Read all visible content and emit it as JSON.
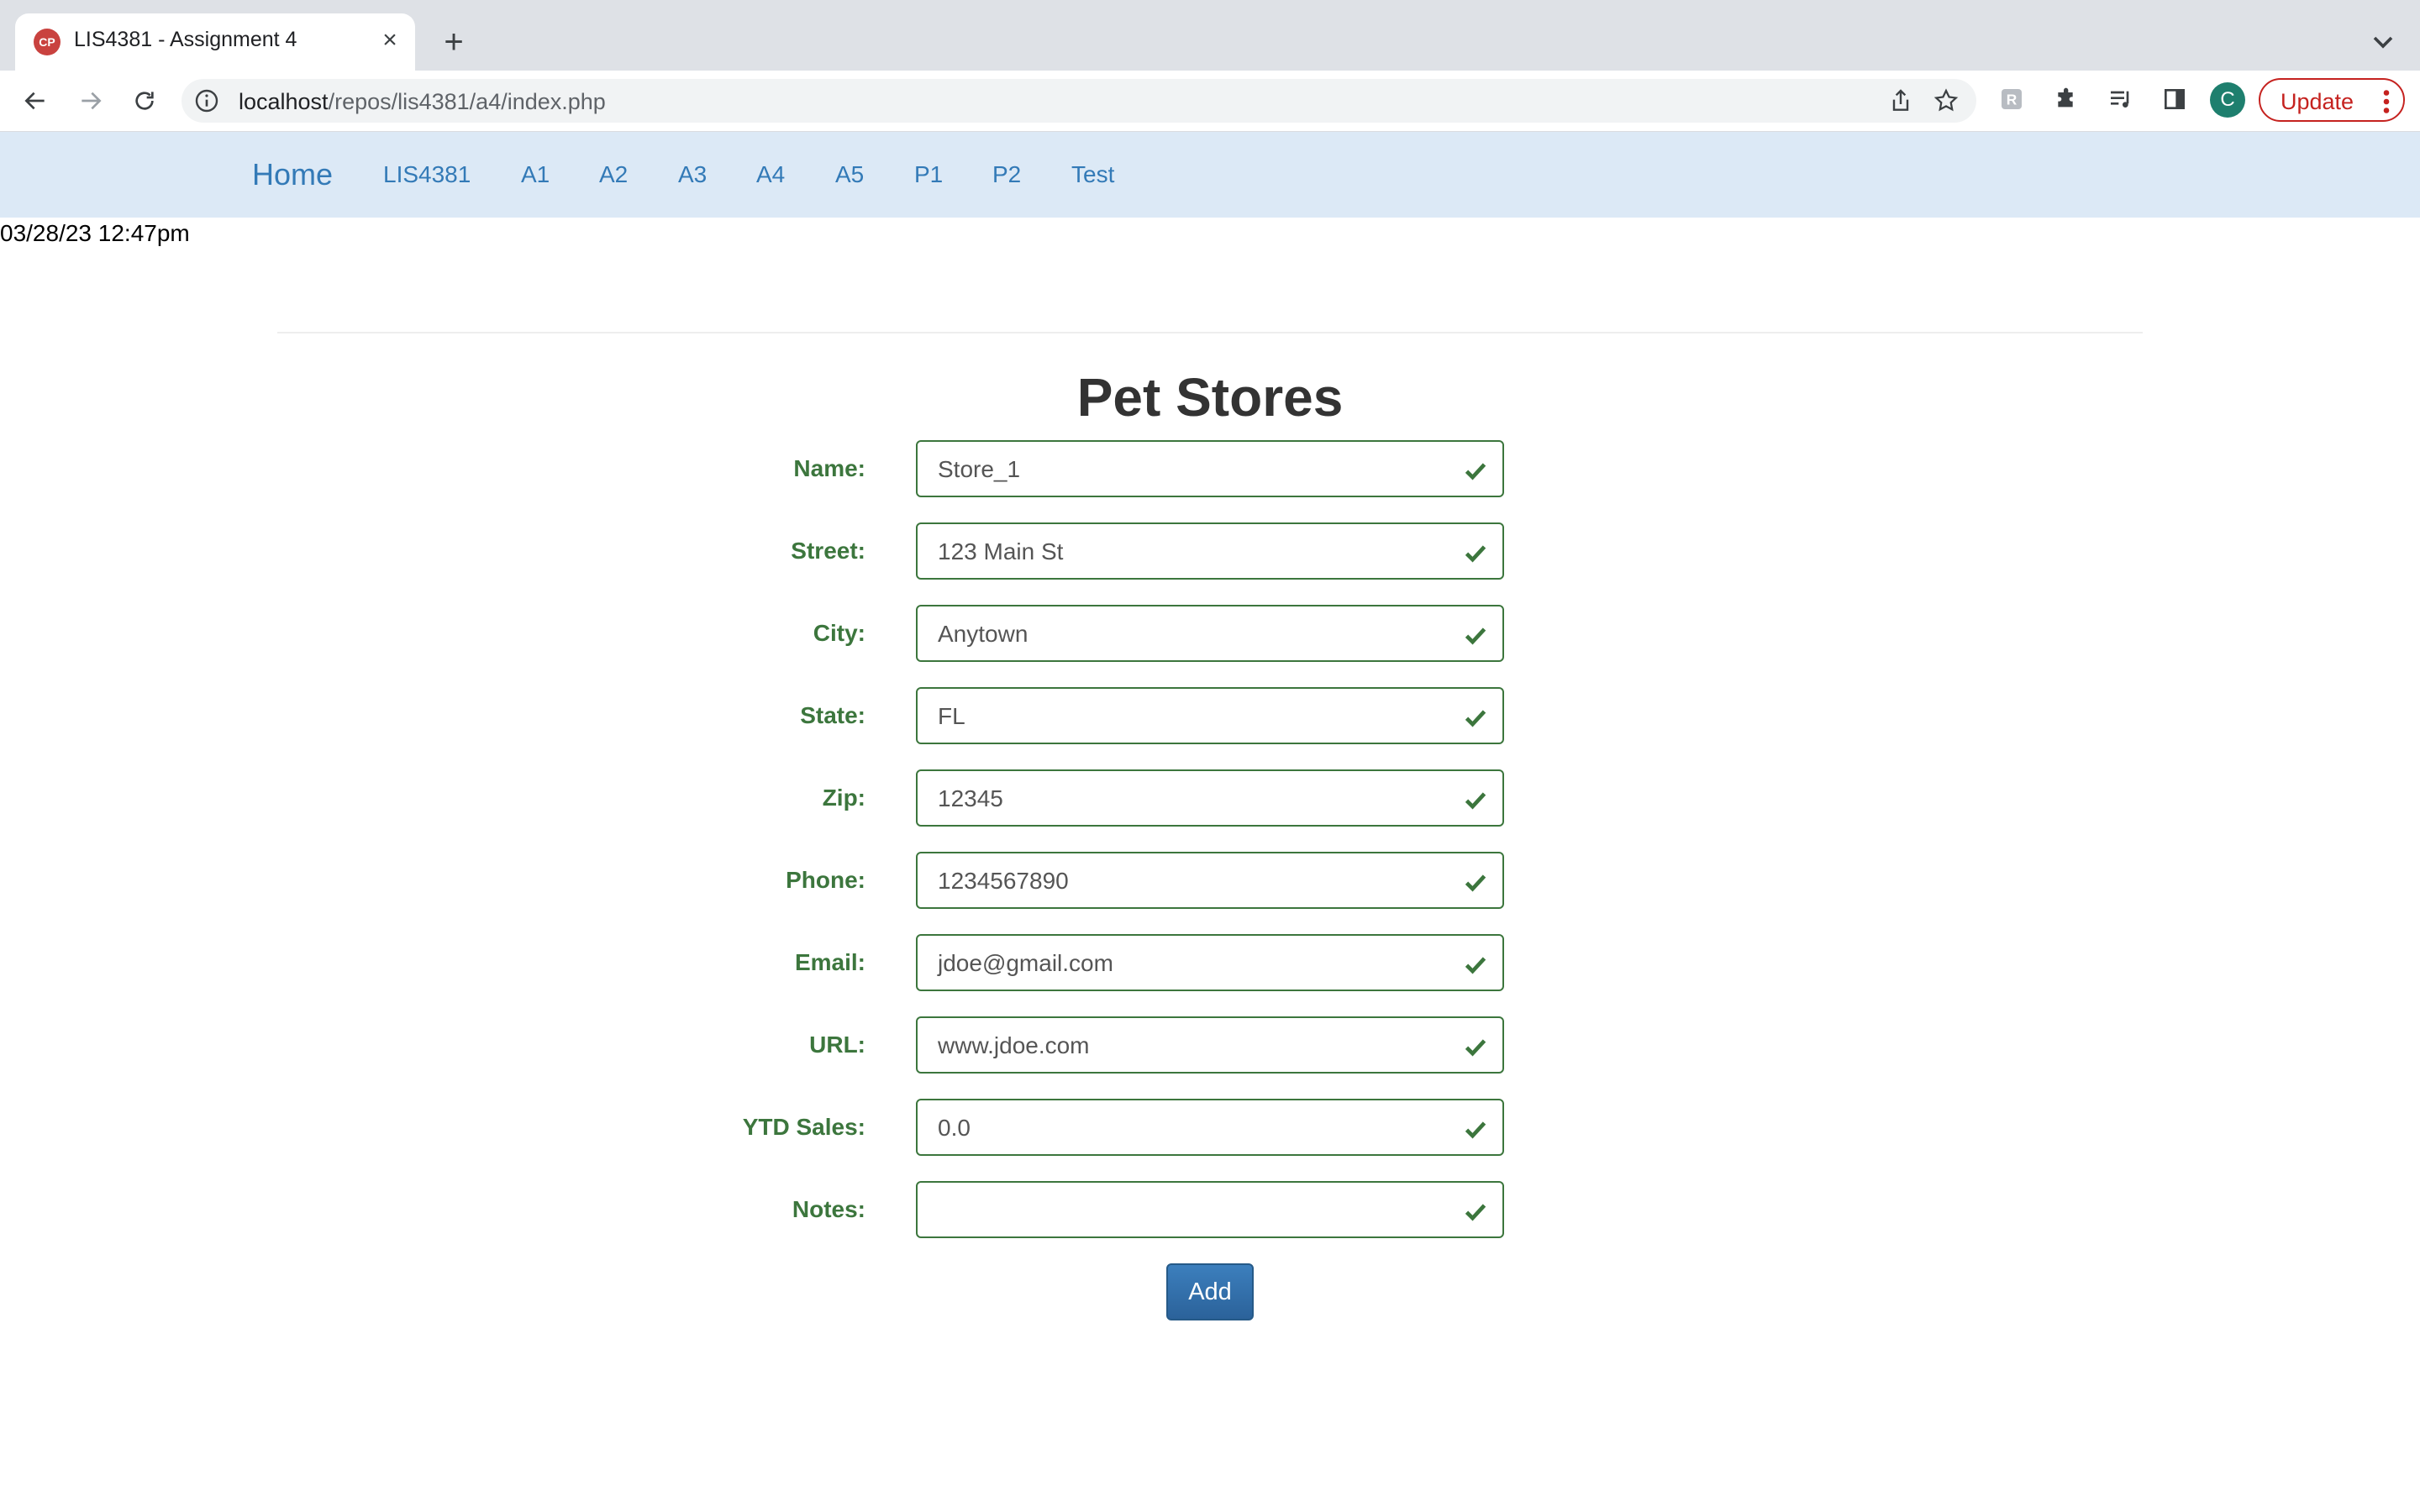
{
  "browser": {
    "tab_title": "LIS4381 - Assignment 4",
    "favicon_text": "CP",
    "url_host": "localhost",
    "url_path": "/repos/lis4381/a4/index.php",
    "avatar_letter": "C",
    "update_label": "Update"
  },
  "nav": {
    "brand": "Home",
    "links": [
      "LIS4381",
      "A1",
      "A2",
      "A3",
      "A4",
      "A5",
      "P1",
      "P2",
      "Test"
    ]
  },
  "datetime": "03/28/23 12:47pm",
  "form": {
    "heading": "Pet Stores",
    "fields": [
      {
        "label": "Name:",
        "value": "Store_1"
      },
      {
        "label": "Street:",
        "value": "123 Main St"
      },
      {
        "label": "City:",
        "value": "Anytown"
      },
      {
        "label": "State:",
        "value": "FL"
      },
      {
        "label": "Zip:",
        "value": "12345"
      },
      {
        "label": "Phone:",
        "value": "1234567890"
      },
      {
        "label": "Email:",
        "value": "jdoe@gmail.com"
      },
      {
        "label": "URL:",
        "value": "www.jdoe.com"
      },
      {
        "label": "YTD Sales:",
        "value": "0.0"
      },
      {
        "label": "Notes:",
        "value": ""
      }
    ],
    "submit_label": "Add",
    "valid_color": "#3c763d"
  }
}
